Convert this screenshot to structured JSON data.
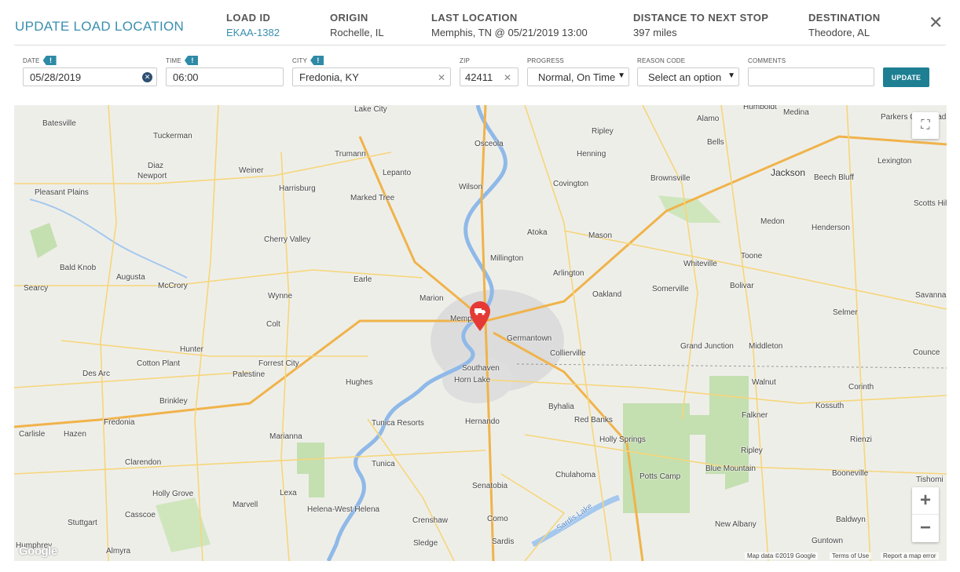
{
  "header": {
    "title": "UPDATE LOAD LOCATION",
    "load_id_label": "LOAD ID",
    "load_id": "EKAA-1382",
    "origin_label": "ORIGIN",
    "origin": "Rochelle, IL",
    "last_location_label": "LAST LOCATION",
    "last_location": "Memphis, TN @ 05/21/2019 13:00",
    "distance_label": "DISTANCE TO NEXT STOP",
    "distance": "397 miles",
    "destination_label": "DESTINATION",
    "destination": "Theodore, AL",
    "close_icon": "close-icon"
  },
  "form": {
    "date_label": "DATE",
    "date_value": "05/28/2019",
    "time_label": "TIME",
    "time_value": "06:00",
    "city_label": "CITY",
    "city_value": "Fredonia, KY",
    "zip_label": "ZIP",
    "zip_value": "42411",
    "progress_label": "PROGRESS",
    "progress_value": "Normal, On Time",
    "reason_label": "REASON CODE",
    "reason_value": "Select an option",
    "comments_label": "COMMENTS",
    "comments_value": "",
    "update_button": "UPDATE",
    "warning_flag": "!",
    "accent_color": "#1e7f93"
  },
  "map": {
    "places": [
      "Batesville",
      "Tuckerman",
      "Diaz",
      "Newport",
      "Pleasant Plains",
      "Weiner",
      "Harrisburg",
      "Trumann",
      "Lepanto",
      "Marked Tree",
      "Lake City",
      "Osceola",
      "Wilson",
      "Ripley",
      "Henning",
      "Covington",
      "Brownsville",
      "Alamo",
      "Bells",
      "Humboldt",
      "Medina",
      "Jackson",
      "Beech Bluff",
      "Lexington",
      "Scotts Hill",
      "Medon",
      "Henderson",
      "Atoka",
      "Mason",
      "Millington",
      "Arlington",
      "Whiteville",
      "Toone",
      "Bolivar",
      "Bald Knob",
      "Augusta",
      "McCrory",
      "Cherry Valley",
      "Earle",
      "Wynne",
      "Marion",
      "Memphis",
      "Oakland",
      "Somerville",
      "Searcy",
      "Colt",
      "Germantown",
      "Collierville",
      "Grand Junction",
      "Middleton",
      "Selmer",
      "Savanna",
      "Hunter",
      "Forrest City",
      "Southaven",
      "Horn Lake",
      "Cotton Plant",
      "Palestine",
      "Des Arc",
      "Hughes",
      "Walnut",
      "Corinth",
      "Brinkley",
      "Byhalia",
      "Kossuth",
      "Falkner",
      "Fredonia",
      "Carlisle",
      "Hazen",
      "Tunica Resorts",
      "Hernando",
      "Red Banks",
      "Holly Springs",
      "Rienzi",
      "Marianna",
      "Clarendon",
      "Ripley",
      "Tunica",
      "Potts Camp",
      "Blue Mountain",
      "Booneville",
      "Holly Grove",
      "Lexa",
      "Senatobia",
      "Chulahoma",
      "Stuttgart",
      "Casscoe",
      "Marvell",
      "Helena-West Helena",
      "Crenshaw",
      "Como",
      "New Albany",
      "Baldwyn",
      "Tishomi",
      "Humphrey",
      "Almyra",
      "Sledge",
      "Sardis",
      "Guntown",
      "Sardis Lake",
      "Parkers Crossroads",
      "Counce"
    ],
    "attribution_data": "Map data ©2019 Google",
    "terms": "Terms of Use",
    "report": "Report a map error",
    "google_logo": "Google",
    "zoom_in": "+",
    "zoom_out": "−",
    "fullscreen_icon": "fullscreen-icon",
    "marker_icon": "truck-marker-icon",
    "marker_color": "#e53935"
  }
}
